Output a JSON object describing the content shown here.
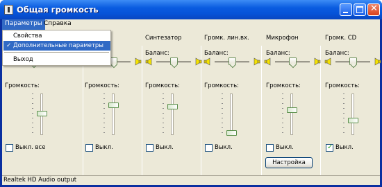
{
  "window": {
    "title": "Общая громкость"
  },
  "menubar": {
    "items": [
      "Параметры",
      "Справка"
    ]
  },
  "dropdown": {
    "items": [
      {
        "label": "Свойства",
        "checked": false
      },
      {
        "label": "Дополнительные параметры",
        "checked": true
      },
      {
        "label": "Выход",
        "checked": false
      }
    ]
  },
  "labels": {
    "balance": "Баланс:",
    "volume": "Громкость:",
    "mute": "Выкл.",
    "mute_all": "Выкл. все"
  },
  "columns": [
    {
      "title": "",
      "muted": false,
      "mute_label": "Выкл. все"
    },
    {
      "title": "",
      "muted": false,
      "mute_label": "Выкл."
    },
    {
      "title": "Синтезатор",
      "muted": false,
      "mute_label": "Выкл."
    },
    {
      "title": "Громк. лин.вх.",
      "muted": false,
      "mute_label": "Выкл."
    },
    {
      "title": "Микрофон",
      "muted": false,
      "mute_label": "Выкл."
    },
    {
      "title": "Громк. CD",
      "muted": true,
      "mute_label": "Выкл."
    }
  ],
  "buttons": {
    "settings": "Настройка"
  },
  "status": {
    "text": "Realtek HD Audio output"
  }
}
